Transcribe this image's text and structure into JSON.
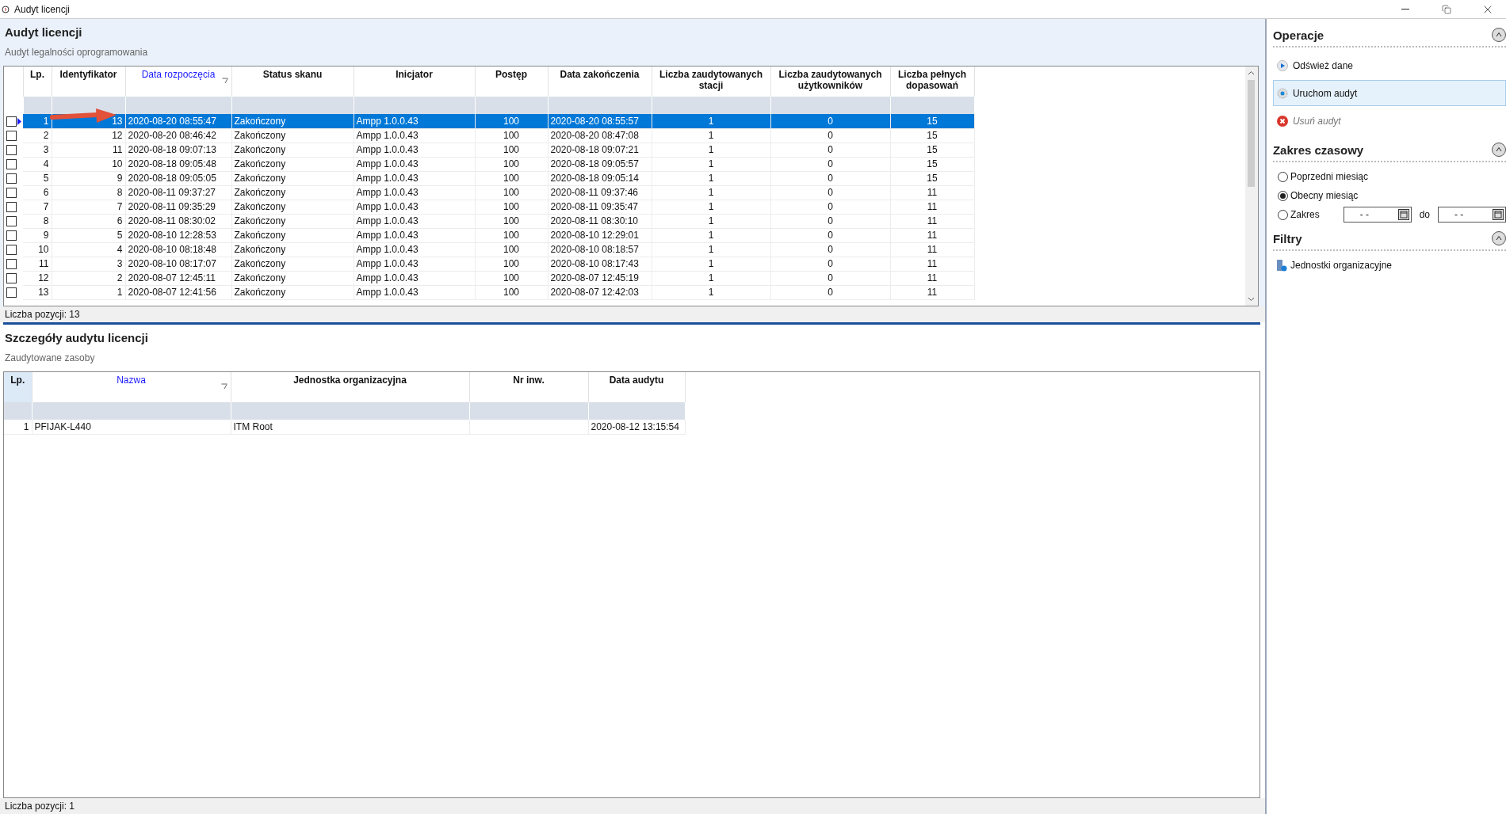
{
  "window": {
    "title": "Audyt licencji"
  },
  "audit": {
    "title": "Audyt licencji",
    "subtitle": "Audyt legalności oprogramowania",
    "columns": [
      {
        "label": "Lp.",
        "sorted": false
      },
      {
        "label": "Identyfikator",
        "sorted": false
      },
      {
        "label": "Data rozpoczęcia",
        "sorted": true
      },
      {
        "label": "Status skanu",
        "sorted": false
      },
      {
        "label": "Inicjator",
        "sorted": false
      },
      {
        "label": "Postęp",
        "sorted": false
      },
      {
        "label": "Data zakończenia",
        "sorted": false
      },
      {
        "label": "Liczba zaudytowanych stacji",
        "sorted": false
      },
      {
        "label": "Liczba zaudytowanych użytkowników",
        "sorted": false
      },
      {
        "label": "Liczba pełnych dopasowań",
        "sorted": false
      }
    ],
    "rows": [
      {
        "selected": true,
        "checked": false,
        "cells": [
          "1",
          "13",
          "2020-08-20 08:55:47",
          "Zakończony",
          "Ampp 1.0.0.43",
          "100",
          "2020-08-20 08:55:57",
          "1",
          "0",
          "15"
        ]
      },
      {
        "selected": false,
        "checked": false,
        "cells": [
          "2",
          "12",
          "2020-08-20 08:46:42",
          "Zakończony",
          "Ampp 1.0.0.43",
          "100",
          "2020-08-20 08:47:08",
          "1",
          "0",
          "15"
        ]
      },
      {
        "selected": false,
        "checked": false,
        "cells": [
          "3",
          "11",
          "2020-08-18 09:07:13",
          "Zakończony",
          "Ampp 1.0.0.43",
          "100",
          "2020-08-18 09:07:21",
          "1",
          "0",
          "15"
        ]
      },
      {
        "selected": false,
        "checked": false,
        "cells": [
          "4",
          "10",
          "2020-08-18 09:05:48",
          "Zakończony",
          "Ampp 1.0.0.43",
          "100",
          "2020-08-18 09:05:57",
          "1",
          "0",
          "15"
        ]
      },
      {
        "selected": false,
        "checked": false,
        "cells": [
          "5",
          "9",
          "2020-08-18 09:05:05",
          "Zakończony",
          "Ampp 1.0.0.43",
          "100",
          "2020-08-18 09:05:14",
          "1",
          "0",
          "15"
        ]
      },
      {
        "selected": false,
        "checked": false,
        "cells": [
          "6",
          "8",
          "2020-08-11 09:37:27",
          "Zakończony",
          "Ampp 1.0.0.43",
          "100",
          "2020-08-11 09:37:46",
          "1",
          "0",
          "11"
        ]
      },
      {
        "selected": false,
        "checked": false,
        "cells": [
          "7",
          "7",
          "2020-08-11 09:35:29",
          "Zakończony",
          "Ampp 1.0.0.43",
          "100",
          "2020-08-11 09:35:47",
          "1",
          "0",
          "11"
        ]
      },
      {
        "selected": false,
        "checked": false,
        "cells": [
          "8",
          "6",
          "2020-08-11 08:30:02",
          "Zakończony",
          "Ampp 1.0.0.43",
          "100",
          "2020-08-11 08:30:10",
          "1",
          "0",
          "11"
        ]
      },
      {
        "selected": false,
        "checked": false,
        "cells": [
          "9",
          "5",
          "2020-08-10 12:28:53",
          "Zakończony",
          "Ampp 1.0.0.43",
          "100",
          "2020-08-10 12:29:01",
          "1",
          "0",
          "11"
        ]
      },
      {
        "selected": false,
        "checked": false,
        "cells": [
          "10",
          "4",
          "2020-08-10 08:18:48",
          "Zakończony",
          "Ampp 1.0.0.43",
          "100",
          "2020-08-10 08:18:57",
          "1",
          "0",
          "11"
        ]
      },
      {
        "selected": false,
        "checked": false,
        "cells": [
          "11",
          "3",
          "2020-08-10 08:17:07",
          "Zakończony",
          "Ampp 1.0.0.43",
          "100",
          "2020-08-10 08:17:43",
          "1",
          "0",
          "11"
        ]
      },
      {
        "selected": false,
        "checked": false,
        "cells": [
          "12",
          "2",
          "2020-08-07 12:45:11",
          "Zakończony",
          "Ampp 1.0.0.43",
          "100",
          "2020-08-07 12:45:19",
          "1",
          "0",
          "11"
        ]
      },
      {
        "selected": false,
        "checked": false,
        "cells": [
          "13",
          "1",
          "2020-08-07 12:41:56",
          "Zakończony",
          "Ampp 1.0.0.43",
          "100",
          "2020-08-07 12:42:03",
          "1",
          "0",
          "11"
        ]
      }
    ],
    "count": "Liczba pozycji: 13"
  },
  "details": {
    "title": "Szczegóły audytu licencji",
    "subtitle": "Zaudytowane zasoby",
    "columns": [
      {
        "label": "Lp.",
        "sorted": false,
        "highlighted": true
      },
      {
        "label": "Nazwa",
        "sorted": true,
        "highlighted": false
      },
      {
        "label": "Jednostka organizacyjna",
        "sorted": false,
        "highlighted": false
      },
      {
        "label": "Nr inw.",
        "sorted": false,
        "highlighted": false
      },
      {
        "label": "Data audytu",
        "sorted": false,
        "highlighted": false
      }
    ],
    "rows": [
      {
        "selected": false,
        "cells": [
          "1",
          "PFIJAK-L440",
          "ITM Root",
          "",
          "2020-08-12 13:15:54"
        ]
      }
    ],
    "count": "Liczba pozycji: 1"
  },
  "sidebar": {
    "sections": [
      {
        "kind": "actions",
        "title": "Operacje",
        "expanded": true,
        "items": [
          {
            "label": "Odśwież dane",
            "highlighted": false,
            "disabled": false
          },
          {
            "label": "Uruchom audyt",
            "highlighted": true,
            "disabled": false
          },
          {
            "label": "Usuń audyt",
            "highlighted": false,
            "disabled": true
          }
        ]
      },
      {
        "kind": "time-range",
        "title": "Zakres czasowy",
        "expanded": true,
        "options": [
          {
            "label": "Poprzedni miesiąc",
            "selected": false
          },
          {
            "label": "Obecny miesiąc",
            "selected": true
          },
          {
            "label": "Zakres",
            "selected": false
          }
        ],
        "range": {
          "from": "- -",
          "separator": "do",
          "to": "- -"
        }
      },
      {
        "kind": "filters",
        "title": "Filtry",
        "expanded": true,
        "items": [
          {
            "label": "Jednostki organizacyjne"
          }
        ]
      }
    ]
  }
}
